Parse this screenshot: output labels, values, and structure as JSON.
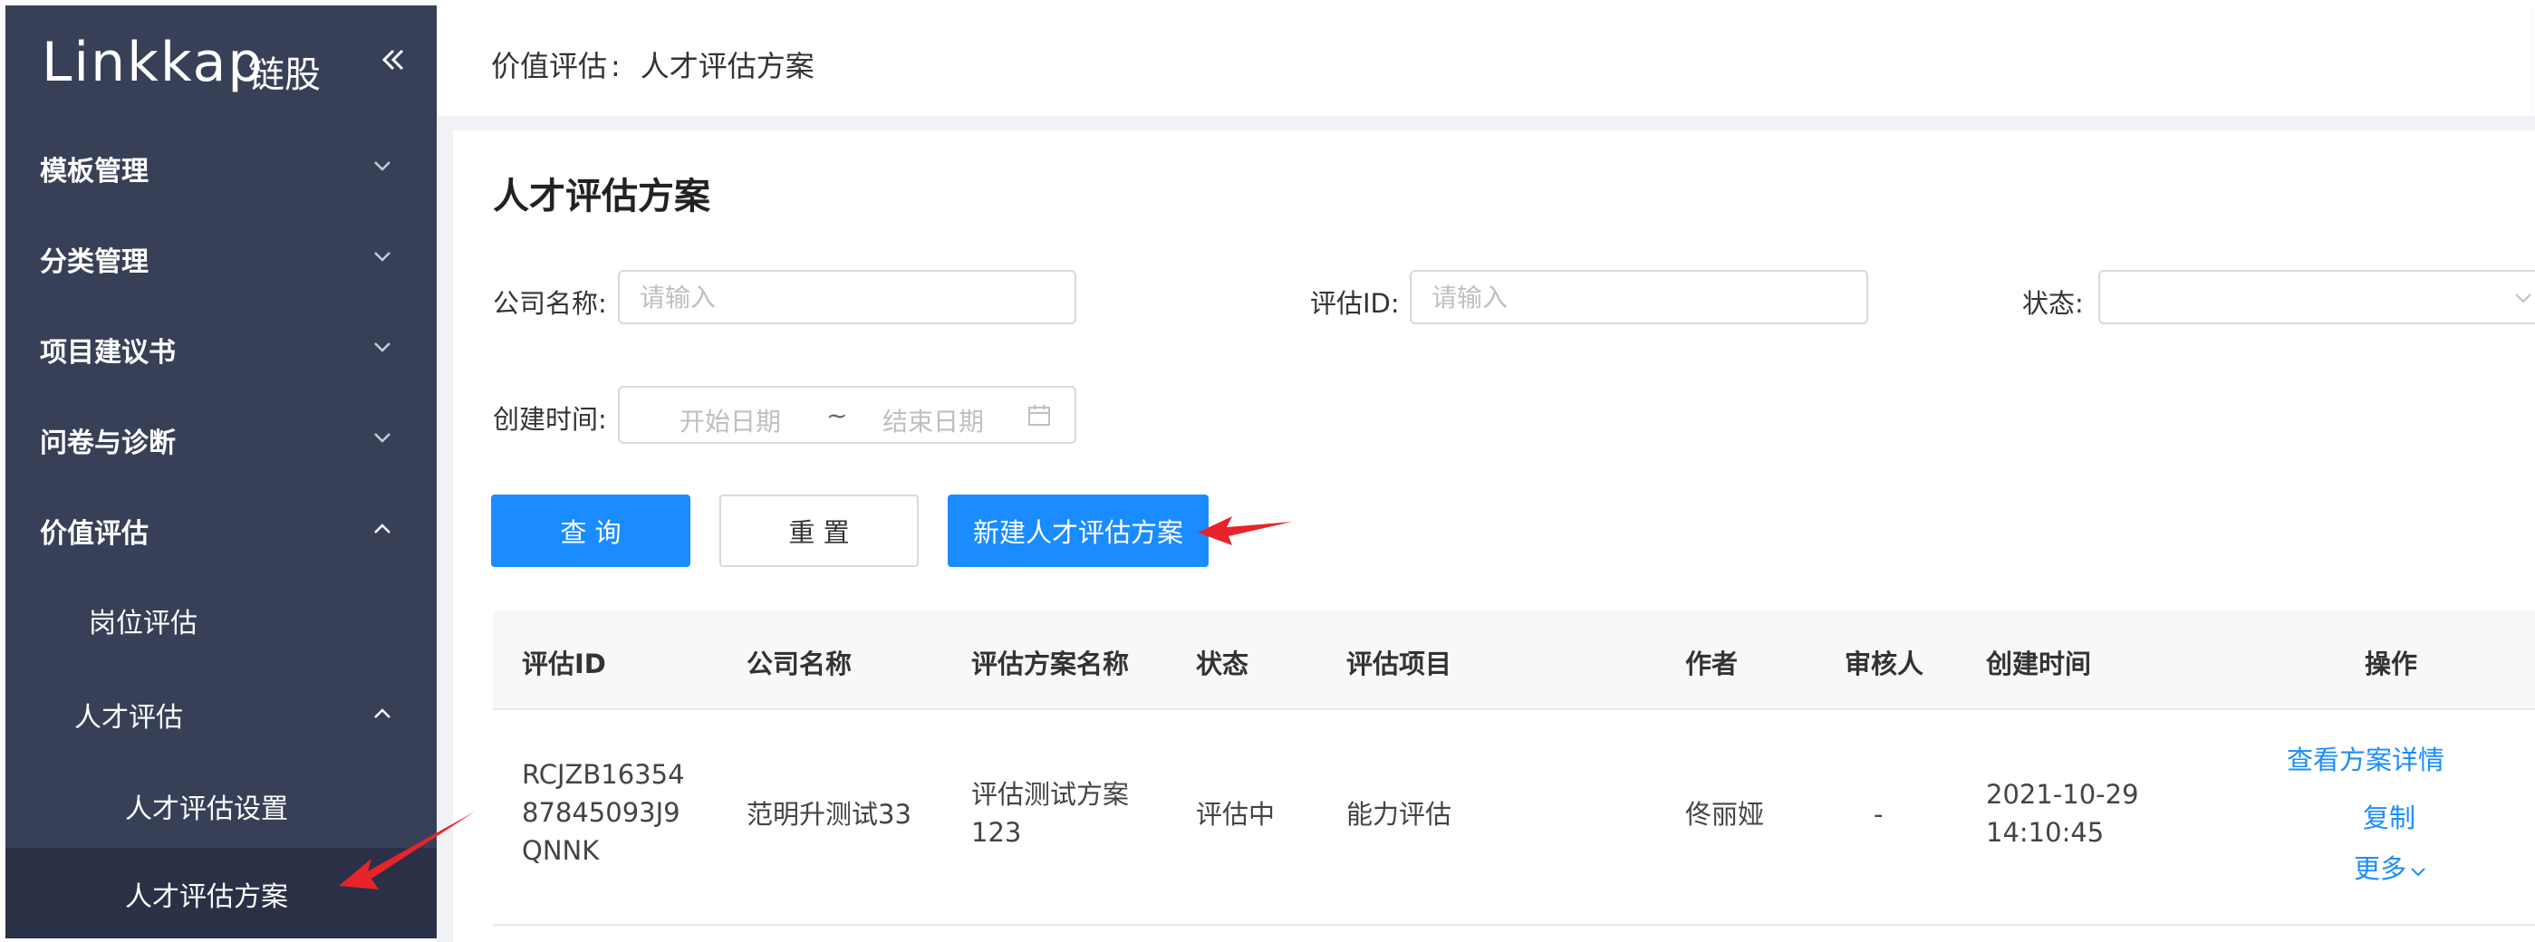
{
  "brand": {
    "logo": "Linkkap",
    "logo_cn": "链股"
  },
  "sidebar": {
    "items": [
      {
        "label": "模板管理"
      },
      {
        "label": "分类管理"
      },
      {
        "label": "项目建议书"
      },
      {
        "label": "问卷与诊断"
      },
      {
        "label": "价值评估"
      },
      {
        "label": "岗位评估"
      },
      {
        "label": "人才评估"
      },
      {
        "label": "人才评估设置"
      },
      {
        "label": "人才评估方案"
      }
    ]
  },
  "breadcrumb": {
    "parent": "价值评估",
    "separator": ":",
    "current": "人才评估方案"
  },
  "page": {
    "title": "人才评估方案"
  },
  "filters": {
    "company_label": "公司名称:",
    "company_placeholder": "请输入",
    "eval_id_label": "评估ID:",
    "eval_id_placeholder": "请输入",
    "status_label": "状态:",
    "status_value": "",
    "created_label": "创建时间:",
    "date_start_placeholder": "开始日期",
    "date_separator": "~",
    "date_end_placeholder": "结束日期"
  },
  "buttons": {
    "query": "查 询",
    "reset": "重 置",
    "create": "新建人才评估方案"
  },
  "table": {
    "columns": [
      "评估ID",
      "公司名称",
      "评估方案名称",
      "状态",
      "评估项目",
      "作者",
      "审核人",
      "创建时间",
      "操作"
    ],
    "rows": [
      {
        "id_lines": [
          "RCJZB16354",
          "87845093J9",
          "QNNK"
        ],
        "company": "范明升测试33",
        "plan_lines": [
          "评估测试方案",
          "123"
        ],
        "status": "评估中",
        "project": "能力评估",
        "author": "佟丽娅",
        "reviewer": "-",
        "created_lines": [
          "2021-10-29",
          "14:10:45"
        ],
        "actions": {
          "view": "查看方案详情",
          "copy": "复制",
          "more": "更多"
        }
      }
    ]
  },
  "colors": {
    "primary": "#1a8cff",
    "sidebar_bg": "#384057",
    "annotation_arrow": "#e8242a"
  }
}
